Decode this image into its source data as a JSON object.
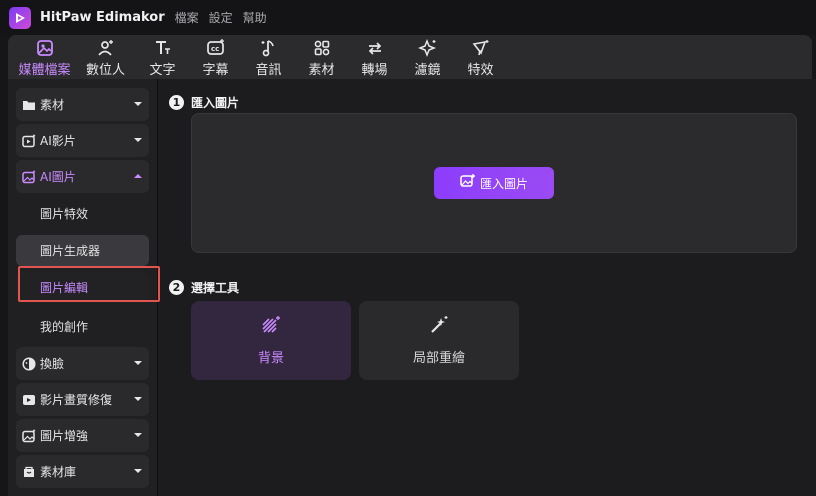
{
  "app": {
    "title": "HitPaw Edimakor",
    "menu": [
      "檔案",
      "設定",
      "幫助"
    ]
  },
  "toolbar": {
    "tabs": [
      {
        "label": "媒體檔案",
        "icon": "media-icon",
        "active": true
      },
      {
        "label": "數位人",
        "icon": "digital-human-icon"
      },
      {
        "label": "文字",
        "icon": "text-icon"
      },
      {
        "label": "字幕",
        "icon": "subtitle-icon"
      },
      {
        "label": "音訊",
        "icon": "audio-icon"
      },
      {
        "label": "素材",
        "icon": "assets-icon"
      },
      {
        "label": "轉場",
        "icon": "transition-icon"
      },
      {
        "label": "濾鏡",
        "icon": "filter-icon"
      },
      {
        "label": "特效",
        "icon": "effects-icon"
      }
    ]
  },
  "sidebar": {
    "items": [
      {
        "label": "素材",
        "icon": "folder-icon"
      },
      {
        "label": "AI影片",
        "icon": "ai-video-icon"
      },
      {
        "label": "AI圖片",
        "icon": "ai-image-icon",
        "open": true
      },
      {
        "label": "換臉",
        "icon": "face-swap-icon"
      },
      {
        "label": "影片畫質修復",
        "icon": "video-enhance-icon"
      },
      {
        "label": "圖片增強",
        "icon": "image-enhance-icon"
      },
      {
        "label": "素材庫",
        "icon": "library-icon"
      }
    ],
    "subitems": [
      {
        "label": "圖片特效"
      },
      {
        "label": "圖片生成器",
        "hover": true
      },
      {
        "label": "圖片編輯",
        "selected": true
      },
      {
        "label": "我的創作"
      }
    ]
  },
  "content": {
    "step1": {
      "num": "1",
      "title": "匯入圖片"
    },
    "import_button": "匯入圖片",
    "step2": {
      "num": "2",
      "title": "選擇工具"
    },
    "tools": [
      {
        "label": "背景",
        "icon": "background-icon",
        "active": true
      },
      {
        "label": "局部重繪",
        "icon": "magic-wand-icon"
      }
    ]
  },
  "colors": {
    "accent": "#c98bff",
    "button": "#8c3dfc",
    "highlight": "#e0554e"
  }
}
